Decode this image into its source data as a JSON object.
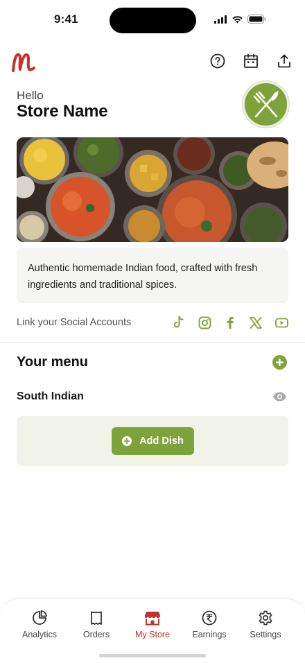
{
  "status_bar": {
    "time": "9:41"
  },
  "top_bar": {
    "logo_color": "#c9302c",
    "actions": [
      "help-icon",
      "calendar-icon",
      "share-icon"
    ]
  },
  "header": {
    "greeting": "Hello",
    "store_name": "Store Name"
  },
  "description": "Authentic homemade Indian food, crafted with fresh ingredients and traditional spices.",
  "social": {
    "label": "Link your Social Accounts",
    "icons": [
      "tiktok-icon",
      "instagram-icon",
      "facebook-icon",
      "x-icon",
      "youtube-icon"
    ]
  },
  "menu": {
    "title": "Your menu",
    "category": "South Indian",
    "add_dish_label": "Add Dish"
  },
  "bottom_nav": {
    "items": [
      {
        "label": "Analytics",
        "icon": "analytics-icon"
      },
      {
        "label": "Orders",
        "icon": "orders-icon"
      },
      {
        "label": "My Store",
        "icon": "store-icon",
        "active": true
      },
      {
        "label": "Earnings",
        "icon": "rupee-icon"
      },
      {
        "label": "Settings",
        "icon": "gear-icon"
      }
    ]
  },
  "colors": {
    "accent": "#7fa33b",
    "brand": "#c9302c",
    "active_nav": "#c0312b"
  }
}
